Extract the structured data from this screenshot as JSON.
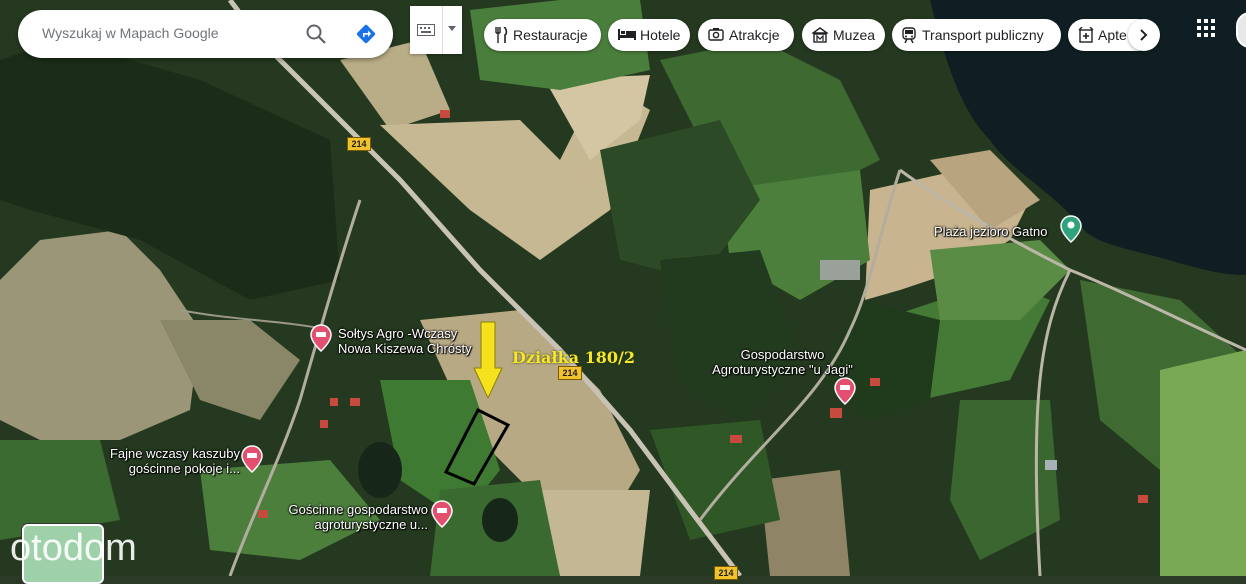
{
  "search": {
    "placeholder": "Wyszukaj w Mapach Google"
  },
  "chips": [
    {
      "label": "Restauracje",
      "icon": "fork-knife-icon"
    },
    {
      "label": "Hotele",
      "icon": "bed-icon"
    },
    {
      "label": "Atrakcje",
      "icon": "camera-icon"
    },
    {
      "label": "Muzea",
      "icon": "museum-icon"
    },
    {
      "label": "Transport publiczny",
      "icon": "train-icon"
    },
    {
      "label": "Apte",
      "icon": "pharmacy-icon"
    }
  ],
  "map": {
    "plot_label": "Działka 180/2",
    "road_number": "214",
    "places": [
      {
        "line1": "Sołtys Agro -Wczasy",
        "line2": "Nowa Kiszewa Chrósty",
        "type": "hotel"
      },
      {
        "line1": "Fajne wczasy kaszuby",
        "line2": "gościnne pokoje i...",
        "type": "hotel"
      },
      {
        "line1": "Gościnne gospodarstwo",
        "line2": "agroturystyczne u...",
        "type": "hotel"
      },
      {
        "line1": "Gospodarstwo",
        "line2": "Agroturystyczne \"u Jagi\"",
        "type": "hotel"
      },
      {
        "line1": "Plaża jezioro Gatno",
        "line2": "",
        "type": "beach"
      }
    ]
  },
  "watermark": "otodom",
  "colors": {
    "hotel_pin": "#e3506f",
    "beach_pin": "#2fa37c",
    "plot_arrow": "#f5e11c",
    "road": "#c9c3b6"
  }
}
